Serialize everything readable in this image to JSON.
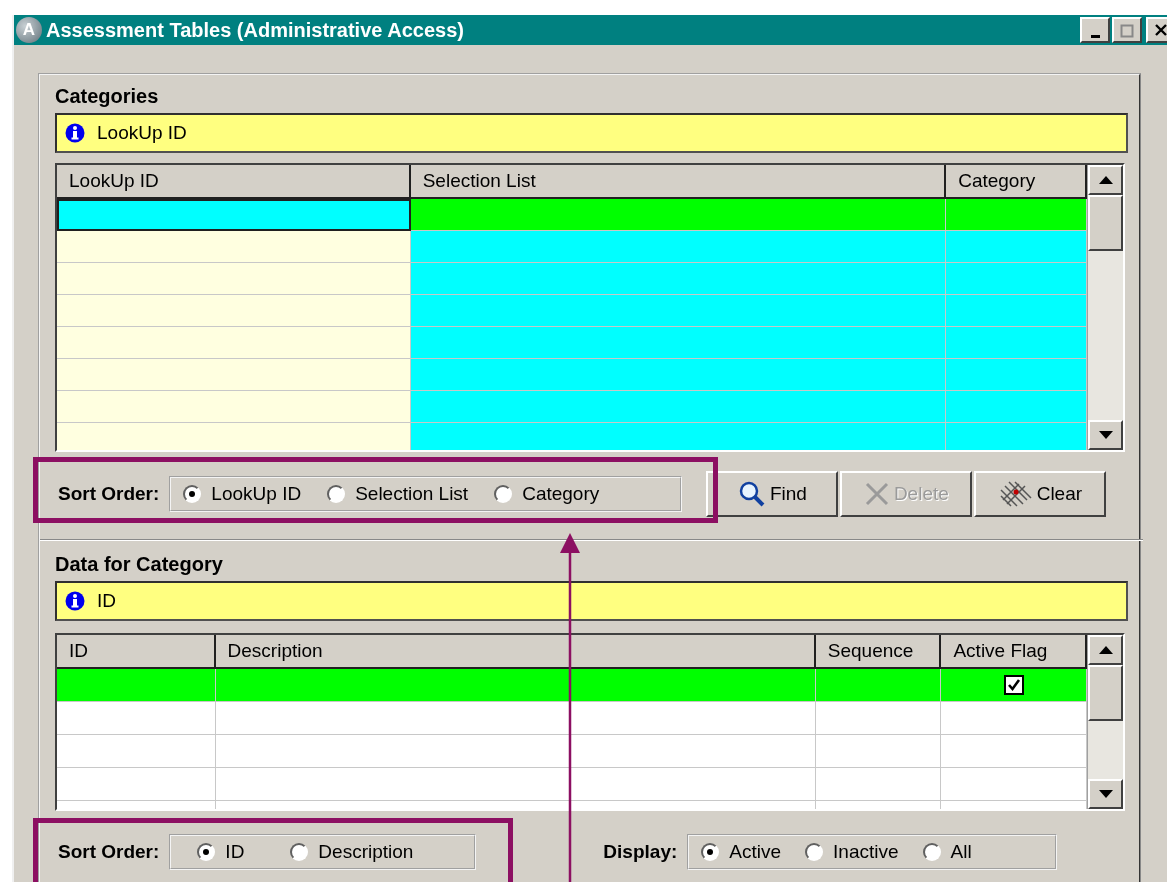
{
  "window": {
    "icon_text": "A",
    "title": "Assessment Tables (Administrative Access)"
  },
  "categories": {
    "title": "Categories",
    "info_text": "LookUp ID",
    "columns": [
      "LookUp ID",
      "Selection List",
      "Category"
    ],
    "rows": [
      {
        "selected": true
      },
      {
        "selected": false
      },
      {
        "selected": false
      },
      {
        "selected": false
      },
      {
        "selected": false
      },
      {
        "selected": false
      },
      {
        "selected": false
      },
      {
        "selected": false
      }
    ],
    "sort_label": "Sort Order:",
    "sort_options": [
      {
        "label": "LookUp ID",
        "selected": true
      },
      {
        "label": "Selection List",
        "selected": false
      },
      {
        "label": "Category",
        "selected": false
      }
    ],
    "buttons": [
      {
        "kind": "find",
        "label": "Find",
        "disabled": false
      },
      {
        "kind": "delete",
        "label": "Delete",
        "disabled": true
      },
      {
        "kind": "clear",
        "label": "Clear",
        "disabled": false
      }
    ]
  },
  "data": {
    "title": "Data for Category",
    "info_text": "ID",
    "columns": [
      "ID",
      "Description",
      "Sequence",
      "Active Flag"
    ],
    "rows": [
      {
        "selected": true,
        "active_flag": true
      },
      {
        "selected": false,
        "active_flag": false
      },
      {
        "selected": false,
        "active_flag": false
      },
      {
        "selected": false,
        "active_flag": false
      },
      {
        "selected": false,
        "active_flag": false
      }
    ],
    "sort_label": "Sort Order:",
    "sort_options": [
      {
        "label": "ID",
        "selected": true
      },
      {
        "label": "Description",
        "selected": false
      }
    ],
    "display_label": "Display:",
    "display_options": [
      {
        "label": "Active",
        "selected": true
      },
      {
        "label": "Inactive",
        "selected": false
      },
      {
        "label": "All",
        "selected": false
      }
    ]
  }
}
